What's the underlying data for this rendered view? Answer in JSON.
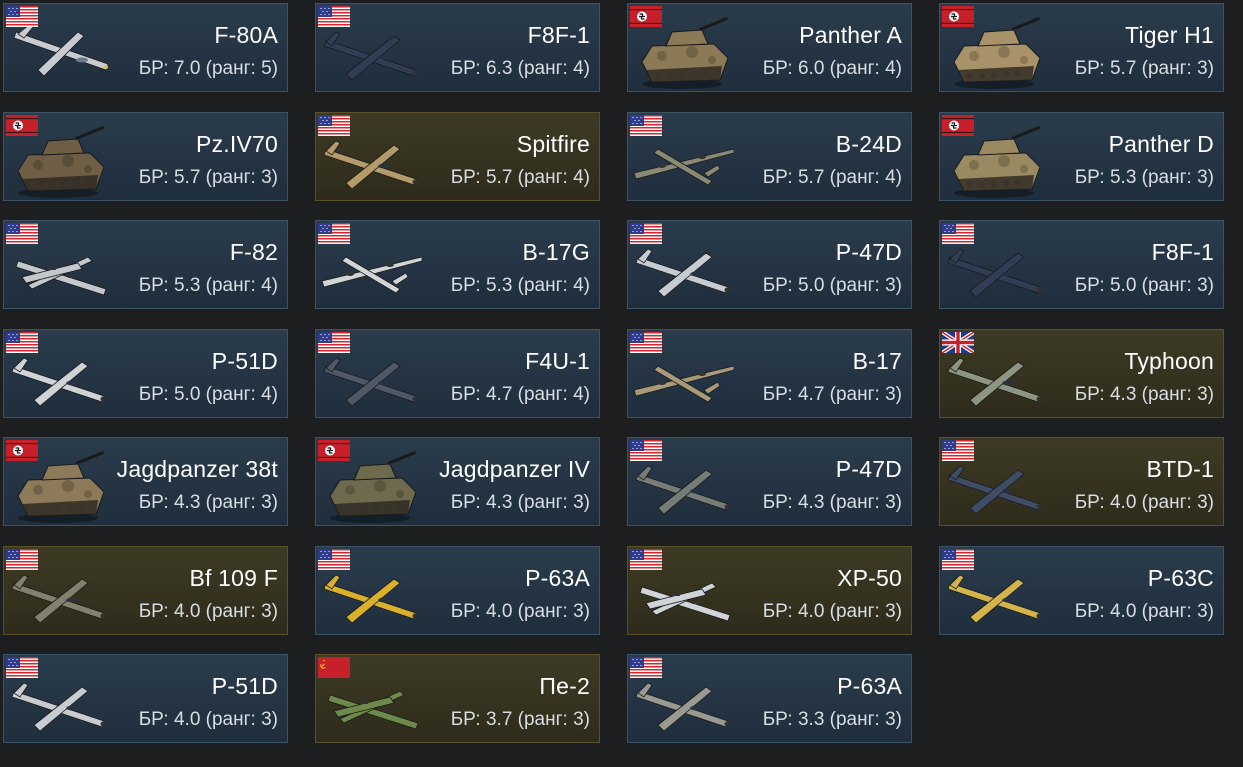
{
  "colors": {
    "page_background": "#1d1e20",
    "card_regular": "#243444",
    "card_premium": "#35321f",
    "name_text": "#ffffff",
    "br_text": "#d7dde3"
  },
  "br_prefix": "БР:",
  "rank_word": "ранг:",
  "vehicles": [
    {
      "name": "F-80A",
      "br": "БР: 7.0 (ранг: 5)",
      "nation": "usa",
      "kind": "jet",
      "color": "#c8ccd0",
      "premium": false
    },
    {
      "name": "F8F-1",
      "br": "БР: 6.3 (ранг: 4)",
      "nation": "usa",
      "kind": "plane",
      "color": "#2f3d55",
      "premium": false
    },
    {
      "name": "Panther A",
      "br": "БР: 6.0 (ранг: 4)",
      "nation": "germany",
      "kind": "tank",
      "color": "#8b7a55",
      "premium": false
    },
    {
      "name": "Tiger H1",
      "br": "БР: 5.7 (ранг: 3)",
      "nation": "germany",
      "kind": "tank",
      "color": "#a8926a",
      "premium": false
    },
    {
      "name": "Pz.IV70",
      "br": "БР: 5.7 (ранг: 3)",
      "nation": "germany",
      "kind": "tank",
      "color": "#6e5e46",
      "premium": false
    },
    {
      "name": "Spitfire",
      "br": "БР: 5.7 (ранг: 4)",
      "nation": "usa",
      "kind": "plane",
      "color": "#b59a6a",
      "premium": true
    },
    {
      "name": "B-24D",
      "br": "БР: 5.7 (ранг: 4)",
      "nation": "usa",
      "kind": "bomber",
      "color": "#8a8a74",
      "premium": false
    },
    {
      "name": "Panther D",
      "br": "БР: 5.3 (ранг: 3)",
      "nation": "germany",
      "kind": "tank",
      "color": "#9a8a62",
      "premium": false
    },
    {
      "name": "F-82",
      "br": "БР: 5.3 (ранг: 4)",
      "nation": "usa",
      "kind": "twin",
      "color": "#c4c8cc",
      "premium": false
    },
    {
      "name": "B-17G",
      "br": "БР: 5.3 (ранг: 4)",
      "nation": "usa",
      "kind": "bomber",
      "color": "#d2d4d6",
      "premium": false
    },
    {
      "name": "P-47D",
      "br": "БР: 5.0 (ранг: 3)",
      "nation": "usa",
      "kind": "plane",
      "color": "#c6ccd2",
      "premium": false
    },
    {
      "name": "F8F-1",
      "br": "БР: 5.0 (ранг: 3)",
      "nation": "usa",
      "kind": "plane",
      "color": "#2f3d55",
      "premium": false
    },
    {
      "name": "P-51D",
      "br": "БР: 5.0 (ранг: 4)",
      "nation": "usa",
      "kind": "plane",
      "color": "#cfd3d6",
      "premium": false
    },
    {
      "name": "F4U-1",
      "br": "БР: 4.7 (ранг: 4)",
      "nation": "usa",
      "kind": "plane",
      "color": "#4e5866",
      "premium": false
    },
    {
      "name": "B-17",
      "br": "БР: 4.7 (ранг: 3)",
      "nation": "usa",
      "kind": "bomber",
      "color": "#a89a78",
      "premium": false
    },
    {
      "name": "Typhoon",
      "br": "БР: 4.3 (ранг: 3)",
      "nation": "uk",
      "kind": "plane",
      "color": "#8e9682",
      "premium": true
    },
    {
      "name": "Jagdpanzer 38t",
      "br": "БР: 4.3 (ранг: 3)",
      "nation": "germany",
      "kind": "tank",
      "color": "#8c7a58",
      "premium": false
    },
    {
      "name": "Jagdpanzer IV",
      "br": "БР: 4.3 (ранг: 3)",
      "nation": "germany",
      "kind": "tank",
      "color": "#6e6a4e",
      "premium": false
    },
    {
      "name": "P-47D",
      "br": "БР: 4.3 (ранг: 3)",
      "nation": "usa",
      "kind": "plane",
      "color": "#767c78",
      "premium": false
    },
    {
      "name": "BTD-1",
      "br": "БР: 4.0 (ранг: 3)",
      "nation": "usa",
      "kind": "plane",
      "color": "#3e4c66",
      "premium": true
    },
    {
      "name": "Bf 109 F",
      "br": "БР: 4.0 (ранг: 3)",
      "nation": "usa",
      "kind": "plane",
      "color": "#84806e",
      "premium": true
    },
    {
      "name": "P-63A",
      "br": "БР: 4.0 (ранг: 3)",
      "nation": "usa",
      "kind": "plane",
      "color": "#d8b02a",
      "premium": false
    },
    {
      "name": "XP-50",
      "br": "БР: 4.0 (ранг: 3)",
      "nation": "usa",
      "kind": "twin",
      "color": "#d0d4d8",
      "premium": true
    },
    {
      "name": "P-63C",
      "br": "БР: 4.0 (ранг: 3)",
      "nation": "usa",
      "kind": "plane",
      "color": "#d4b44a",
      "premium": false
    },
    {
      "name": "P-51D",
      "br": "БР: 4.0 (ранг: 3)",
      "nation": "usa",
      "kind": "plane",
      "color": "#c8ccd0",
      "premium": false
    },
    {
      "name": "Пе-2",
      "br": "БР: 3.7 (ранг: 3)",
      "nation": "ussr",
      "kind": "twin",
      "color": "#6e8a4a",
      "premium": true
    },
    {
      "name": "P-63A",
      "br": "БР: 3.3 (ранг: 3)",
      "nation": "usa",
      "kind": "plane",
      "color": "#9a9a92",
      "premium": false
    }
  ]
}
